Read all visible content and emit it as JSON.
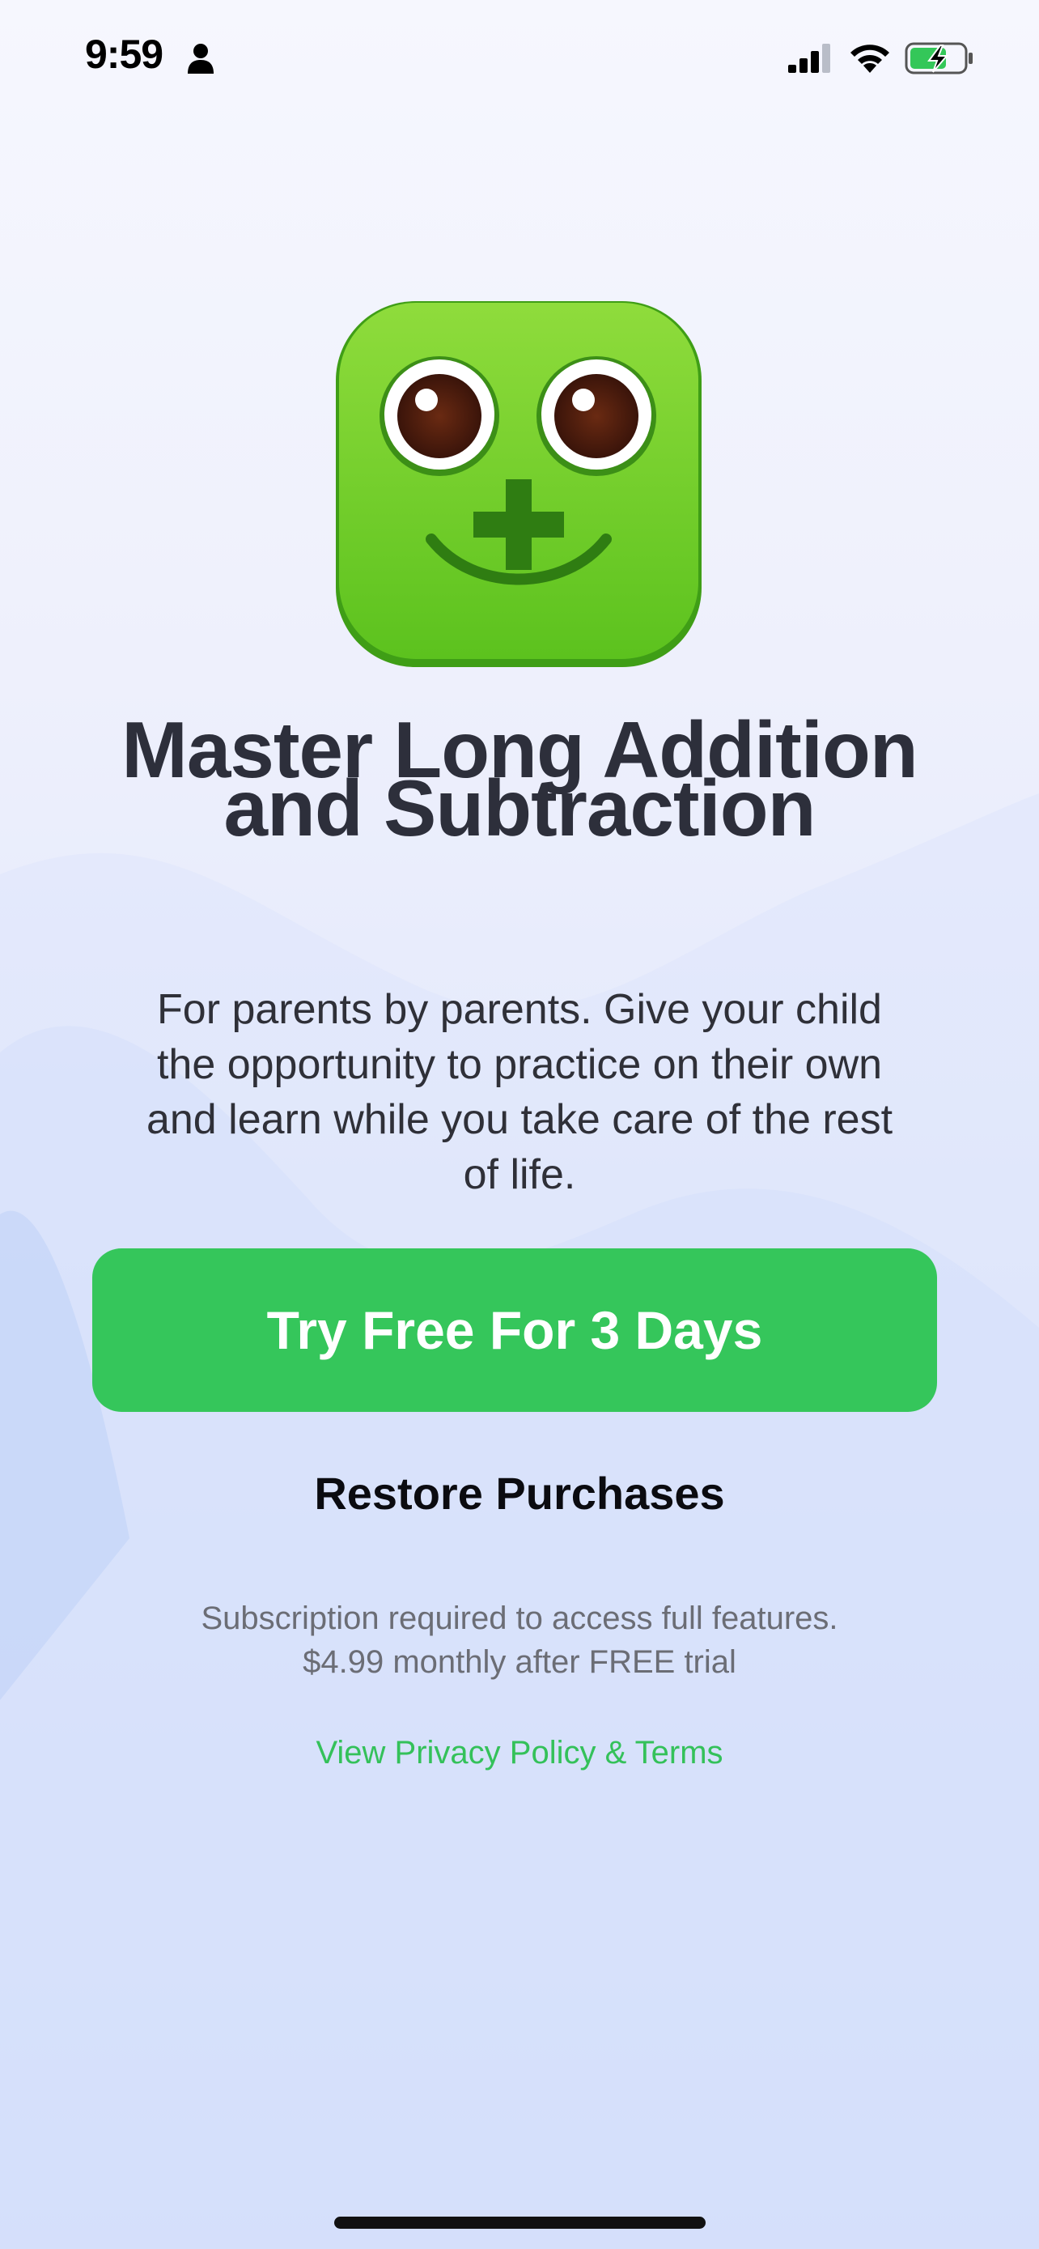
{
  "status_bar": {
    "time": "9:59",
    "icons": [
      "person-icon",
      "cellular-signal-icon",
      "wifi-icon",
      "battery-charging-icon"
    ]
  },
  "app_icon": {
    "name": "app-icon-smiley-plus",
    "accent": "#6fcf26"
  },
  "headline": {
    "line1": "Master Long Addition",
    "line2": "and Subtraction"
  },
  "description": {
    "lines": [
      "For parents by parents. Give your child",
      "the opportunity to practice on their own",
      "and learn while you take care of the rest",
      "of life."
    ]
  },
  "cta": {
    "label": "Try Free For 3 Days",
    "color": "#35c65b"
  },
  "restore": {
    "label": "Restore Purchases"
  },
  "terms": {
    "line1": "Subscription required to access full features.",
    "line2": "$4.99 monthly after FREE trial"
  },
  "privacy": {
    "label": "View Privacy Policy & Terms",
    "color": "#34c15a"
  }
}
